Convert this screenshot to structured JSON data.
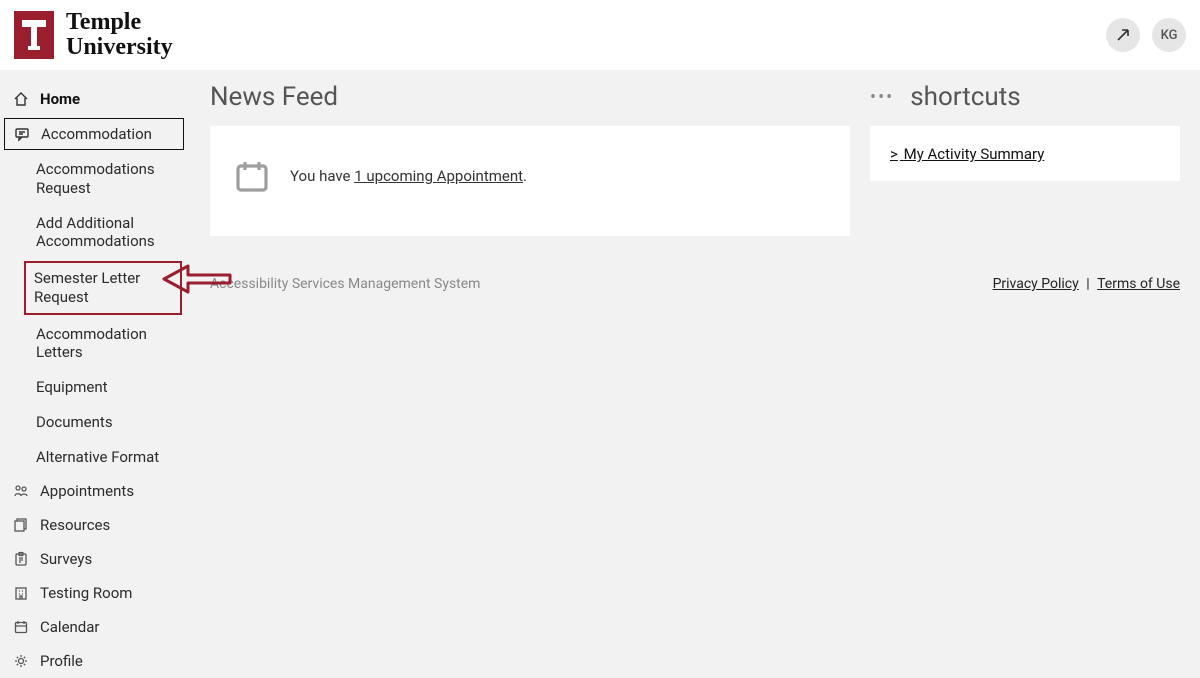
{
  "header": {
    "org_name_line1": "Temple",
    "org_name_line2": "University",
    "avatar_initials": "KG"
  },
  "sidebar": {
    "home": "Home",
    "accommodation": "Accommodation",
    "sub": {
      "accommodations_request": "Accommodations Request",
      "add_additional": "Add Additional Accommodations",
      "semester_letter": "Semester Letter Request",
      "accommodation_letters": "Accommodation Letters",
      "equipment": "Equipment",
      "documents": "Documents",
      "alternative_format": "Alternative Format"
    },
    "appointments": "Appointments",
    "resources": "Resources",
    "surveys": "Surveys",
    "testing_room": "Testing Room",
    "calendar": "Calendar",
    "profile": "Profile"
  },
  "main": {
    "news_title": "News Feed",
    "news_prefix": "You have ",
    "news_link": "1 upcoming Appointment",
    "news_suffix": ".",
    "shortcuts_title": "shortcuts",
    "activity_summary": "My Activity Summary"
  },
  "footer": {
    "system_name": "Accessibility Services Management System",
    "privacy": "Privacy Policy",
    "separator": " | ",
    "terms": "Terms of Use"
  }
}
